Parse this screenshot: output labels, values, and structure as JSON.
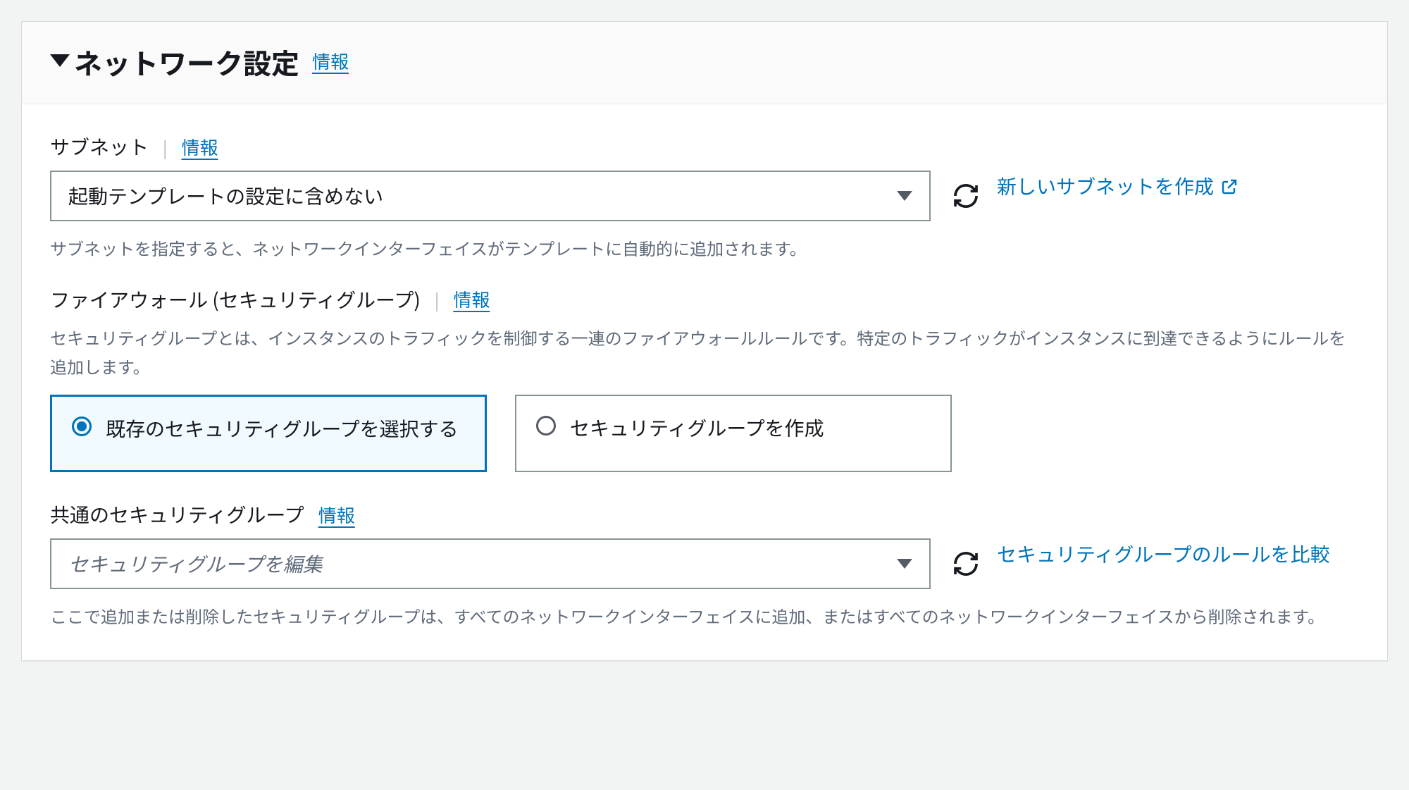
{
  "panel": {
    "title": "ネットワーク設定",
    "info_label": "情報"
  },
  "subnet": {
    "label": "サブネット",
    "info_label": "情報",
    "selected_value": "起動テンプレートの設定に含めない",
    "create_link": "新しいサブネットを作成",
    "helper": "サブネットを指定すると、ネットワークインターフェイスがテンプレートに自動的に追加されます。"
  },
  "firewall": {
    "label": "ファイアウォール (セキュリティグループ)",
    "info_label": "情報",
    "description": "セキュリティグループとは、インスタンスのトラフィックを制御する一連のファイアウォールルールです。特定のトラフィックがインスタンスに到達できるようにルールを追加します。",
    "option_existing": "既存のセキュリティグループを選択する",
    "option_create": "セキュリティグループを作成"
  },
  "common_sg": {
    "label": "共通のセキュリティグループ",
    "info_label": "情報",
    "placeholder": "セキュリティグループを編集",
    "compare_link": "セキュリティグループのルールを比較",
    "helper": "ここで追加または削除したセキュリティグループは、すべてのネットワークインターフェイスに追加、またはすべてのネットワークインターフェイスから削除されます。"
  }
}
